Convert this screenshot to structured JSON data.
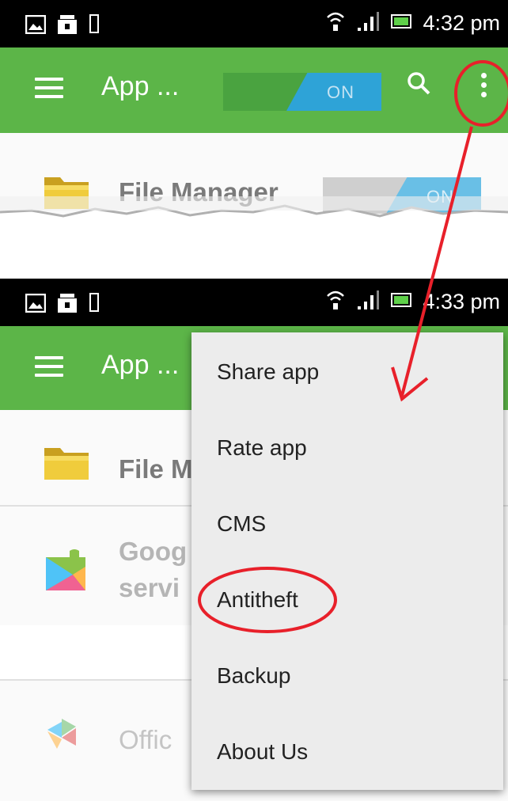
{
  "top_screen": {
    "status_time": "4:32 pm",
    "app_title": "App ...",
    "toggle_label": "ON",
    "file_manager_label": "File Manager",
    "file_manager_toggle": "ON"
  },
  "bottom_screen": {
    "status_time": "4:33 pm",
    "app_title": "App ...",
    "file_manager_label": "File M",
    "google_label_line1": "Goog",
    "google_label_line2": "servi",
    "office_label": "Offic"
  },
  "overflow_menu": {
    "items": [
      "Share app",
      "Rate app",
      "CMS",
      "Antitheft",
      "Backup",
      "About Us"
    ]
  },
  "colors": {
    "appbar": "#5cb548",
    "toggle_on": "#2ea3d7",
    "annotation": "#e8202a",
    "folder": "#e7c232"
  },
  "icons": [
    "menu-icon",
    "search-icon",
    "overflow-menu-icon",
    "folder-icon",
    "puzzle-icon",
    "office-icon",
    "wifi-icon",
    "signal-icon",
    "battery-icon",
    "image-icon",
    "briefcase-icon",
    "phone-icon"
  ]
}
